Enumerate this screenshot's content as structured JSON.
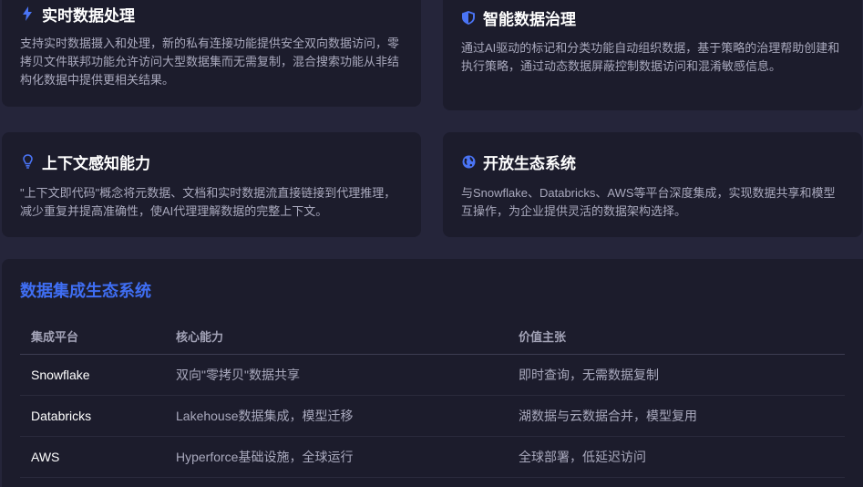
{
  "features": [
    {
      "icon": "lightning-icon",
      "title": "实时数据处理",
      "desc": "支持实时数据摄入和处理，新的私有连接功能提供安全双向数据访问，零拷贝文件联邦功能允许访问大型数据集而无需复制，混合搜索功能从非结构化数据中提供更相关结果。"
    },
    {
      "icon": "shield-icon",
      "title": "智能数据治理",
      "desc": "通过AI驱动的标记和分类功能自动组织数据，基于策略的治理帮助创建和执行策略，通过动态数据屏蔽控制数据访问和混淆敏感信息。"
    },
    {
      "icon": "lightbulb-icon",
      "title": "上下文感知能力",
      "desc": "\"上下文即代码\"概念将元数据、文档和实时数据流直接链接到代理推理，减少重复并提高准确性，使AI代理理解数据的完整上下文。"
    },
    {
      "icon": "globe-icon",
      "title": "开放生态系统",
      "desc": "与Snowflake、Databricks、AWS等平台深度集成，实现数据共享和模型互操作，为企业提供灵活的数据架构选择。"
    }
  ],
  "ecosystem": {
    "title": "数据集成生态系统",
    "headers": [
      "集成平台",
      "核心能力",
      "价值主张"
    ],
    "rows": [
      [
        "Snowflake",
        "双向\"零拷贝\"数据共享",
        "即时查询，无需数据复制"
      ],
      [
        "Databricks",
        "Lakehouse数据集成，模型迁移",
        "湖数据与云数据合并，模型复用"
      ],
      [
        "AWS",
        "Hyperforce基础设施，全球运行",
        "全球部署，低延迟访问"
      ]
    ]
  },
  "colors": {
    "accent": "#3f6ef3",
    "icon": "#4a74f5",
    "background": "#25253a",
    "card": "#1c1c2c"
  }
}
